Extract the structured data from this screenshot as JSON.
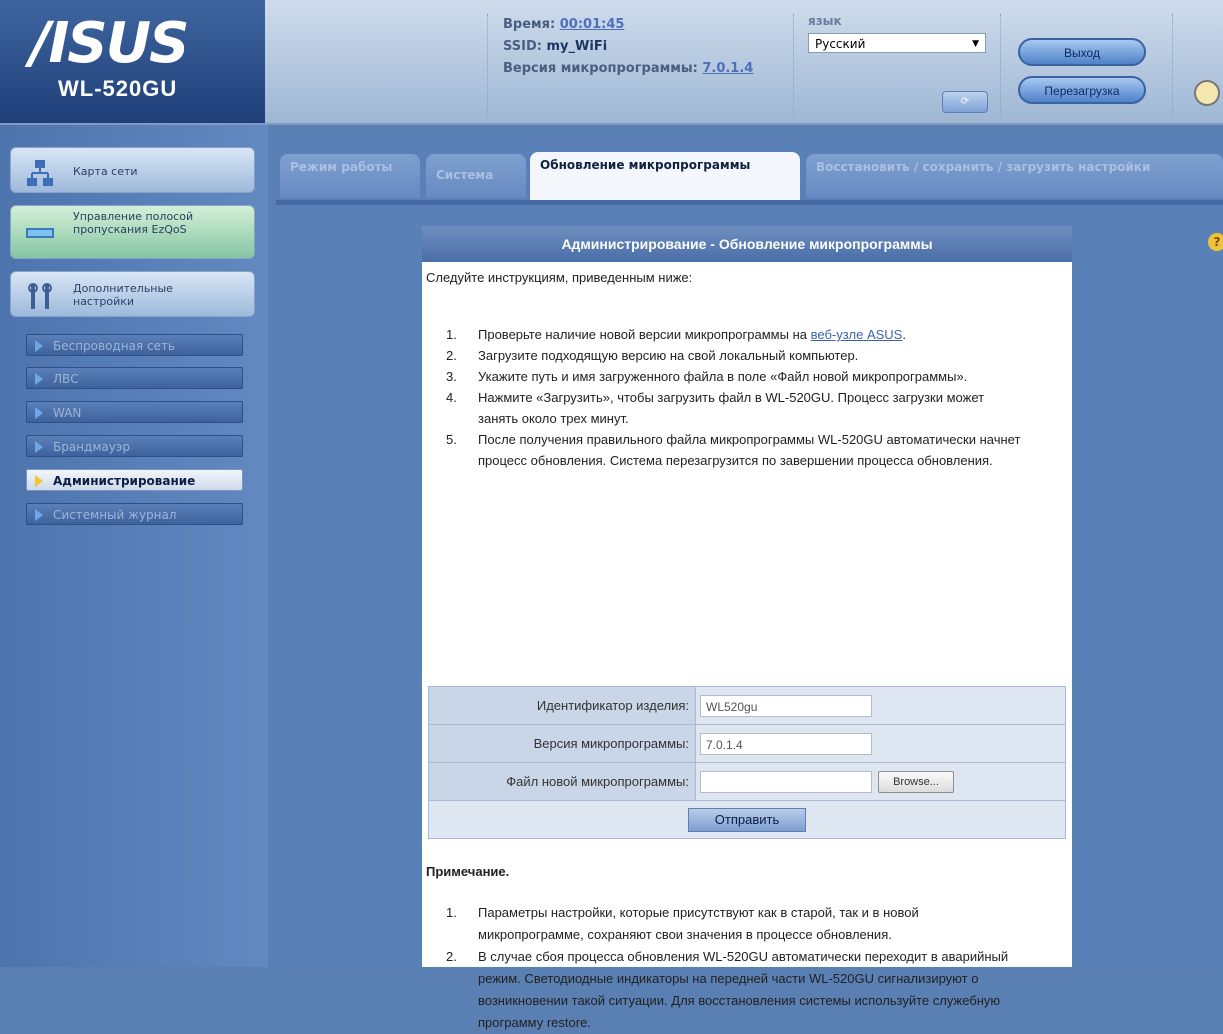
{
  "header": {
    "logo": "/ISUS",
    "model": "WL-520GU",
    "time_label": "Время:",
    "time_value": "00:01:45",
    "ssid_label": "SSID:",
    "ssid_value": "my_WiFi",
    "firmware_label": "Версия микропрограммы:",
    "firmware_value": "7.0.1.4",
    "language_label": "язык",
    "language_selected": "Русский",
    "apply_label": "",
    "logout_label": "Выход",
    "reboot_label": "Перезагрузка"
  },
  "sidebar": {
    "items": [
      {
        "label": "Карта сети",
        "icon": "network-map-icon"
      },
      {
        "label": "Управление полосой пропускания EzQoS",
        "icon": "ezqos-icon"
      },
      {
        "label": "Дополнительные настройки",
        "icon": "tools-icon"
      }
    ],
    "nav": [
      {
        "label": "Беспроводная сеть"
      },
      {
        "label": "ЛВС"
      },
      {
        "label": "WAN"
      },
      {
        "label": "Брандмауэр"
      },
      {
        "label": "Администрирование"
      },
      {
        "label": "Системный журнал"
      }
    ]
  },
  "tabs": [
    {
      "label": "Режим работы"
    },
    {
      "label": "Система"
    },
    {
      "label": "Обновление микропрограммы"
    },
    {
      "label": "Восстановить / сохранить / загрузить настройки"
    }
  ],
  "panel": {
    "title": "Администрирование - Обновление микропрограммы",
    "intro": "Следуйте инструкциям, приведенным ниже:",
    "steps": [
      {
        "num": "1.",
        "text": "Проверьте наличие новой версии микропрограммы на ",
        "link": "веб-узле ASUS",
        "after": "."
      },
      {
        "num": "2.",
        "text": "Загрузите подходящую версию на свой локальный компьютер."
      },
      {
        "num": "3.",
        "text": "Укажите путь и имя загруженного файла в поле «Файл новой микропрограммы»."
      },
      {
        "num": "4.",
        "text": "Нажмите «Загрузить», чтобы загрузить файл в WL-520GU. Процесс загрузки может занять около трех минут."
      },
      {
        "num": "5.",
        "text": "После получения правильного файла микропрограммы WL-520GU автоматически начнет процесс обновления. Система перезагрузится по завершении процесса обновления."
      }
    ],
    "form": {
      "product_id_label": "Идентификатор изделия:",
      "product_id_value": "WL520gu",
      "fw_version_label": "Версия микропрограммы:",
      "fw_version_value": "7.0.1.4",
      "new_fw_label": "Файл новой микропрограммы:",
      "new_fw_value": "",
      "browse_label": "Browse...",
      "submit_label": "Отправить"
    },
    "note_title": "Примечание.",
    "notes": [
      {
        "num": "1.",
        "text": "Параметры настройки, которые присутствуют как в старой, так и в новой микропрограмме, сохраняют свои значения в процессе обновления."
      },
      {
        "num": "2.",
        "text": "В случае сбоя процесса обновления WL-520GU автоматически переходит в аварийный режим. Светодиодные индикаторы на передней части WL-520GU сигнализируют о возникновении такой ситуации. Для восстановления системы используйте служебную программу restore."
      }
    ]
  }
}
